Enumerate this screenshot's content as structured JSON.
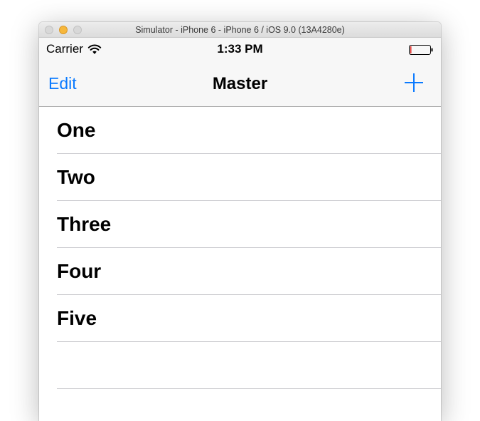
{
  "window": {
    "title": "Simulator - iPhone 6 - iPhone 6 / iOS 9.0 (13A4280e)"
  },
  "status_bar": {
    "carrier": "Carrier",
    "time": "1:33 PM",
    "wifi_icon": "wifi-icon",
    "battery_icon": "battery-icon"
  },
  "nav_bar": {
    "edit_label": "Edit",
    "title": "Master",
    "add_icon": "plus-icon",
    "accent_color": "#0a7aff"
  },
  "table": {
    "rows": [
      {
        "label": "One"
      },
      {
        "label": "Two"
      },
      {
        "label": "Three"
      },
      {
        "label": "Four"
      },
      {
        "label": "Five"
      },
      {
        "label": ""
      }
    ]
  }
}
